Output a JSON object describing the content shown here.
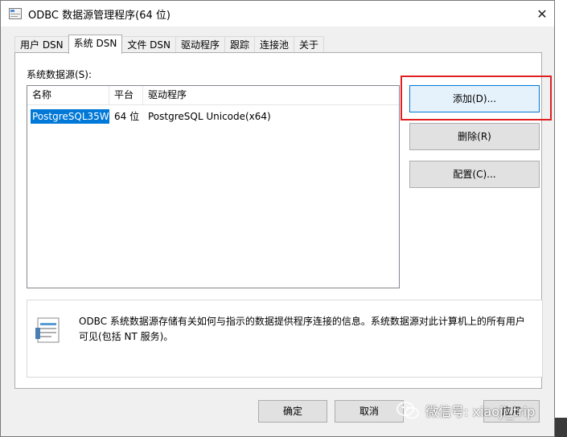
{
  "window": {
    "title": "ODBC 数据源管理程序(64 位)",
    "close_label": "✕"
  },
  "tabs": [
    {
      "label": "用户 DSN",
      "active": false
    },
    {
      "label": "系统 DSN",
      "active": true
    },
    {
      "label": "文件 DSN",
      "active": false
    },
    {
      "label": "驱动程序",
      "active": false
    },
    {
      "label": "跟踪",
      "active": false
    },
    {
      "label": "连接池",
      "active": false
    },
    {
      "label": "关于",
      "active": false
    }
  ],
  "panel": {
    "label": "系统数据源(S):",
    "columns": {
      "name": "名称",
      "platform": "平台",
      "driver": "驱动程序"
    },
    "rows": [
      {
        "name": "PostgreSQL35W",
        "platform": "64 位",
        "driver": "PostgreSQL Unicode(x64)"
      }
    ]
  },
  "buttons": {
    "add": "添加(D)...",
    "remove": "删除(R)",
    "configure": "配置(C)..."
  },
  "info": {
    "text": "ODBC 系统数据源存储有关如何与指示的数据提供程序连接的信息。系统数据源对此计算机上的所有用户可见(包括 NT 服务)。"
  },
  "bottom_buttons": {
    "ok": "确定",
    "cancel": "取消",
    "apply": "应用"
  },
  "watermark": {
    "text": "微信号: xiaoji_trip"
  },
  "colors": {
    "selection": "#0078d7",
    "highlight": "#e02020"
  }
}
